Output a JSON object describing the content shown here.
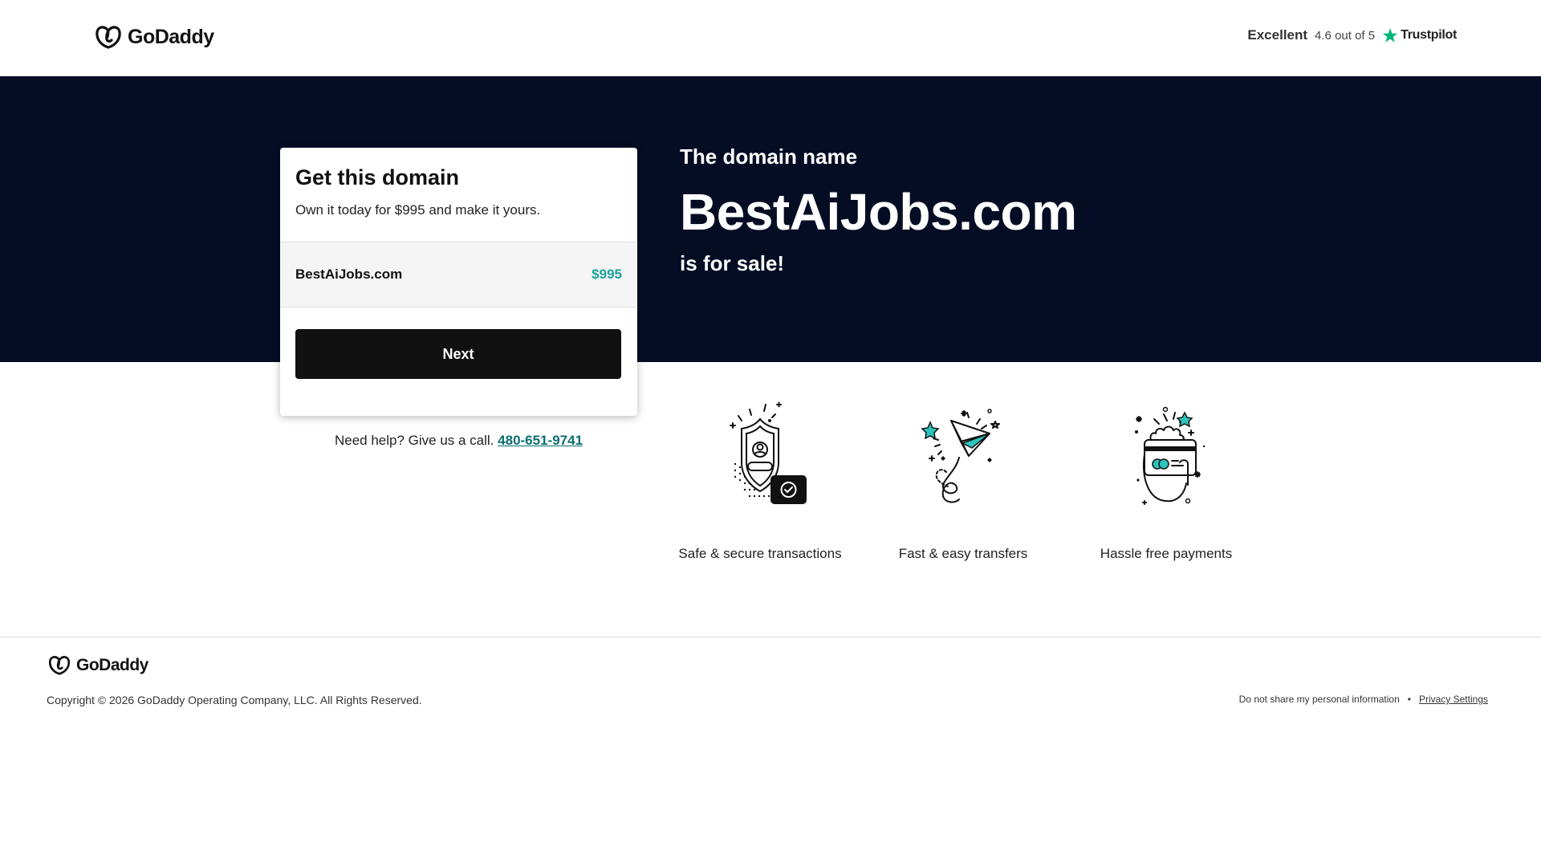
{
  "header": {
    "logo_text": "GoDaddy",
    "trustpilot": {
      "rating_word": "Excellent",
      "score_text": "4.6 out of 5",
      "brand": "Trustpilot",
      "star_color": "#00b67a"
    }
  },
  "hero": {
    "pre_text": "The domain name",
    "domain": "BestAiJobs.com",
    "post_text": "is for sale!",
    "background_color": "#040d24"
  },
  "card": {
    "title": "Get this domain",
    "subtitle": "Own it today for $995 and make it yours.",
    "item_name": "BestAiJobs.com",
    "item_price": "$995",
    "price_color": "#1ba39c",
    "button_label": "Next"
  },
  "help": {
    "text": "Need help? Give us a call.",
    "phone": "480-651-9741"
  },
  "features": [
    {
      "icon": "shield-icon",
      "label": "Safe & secure transactions"
    },
    {
      "icon": "paper-plane-icon",
      "label": "Fast & easy transfers"
    },
    {
      "icon": "credit-card-icon",
      "label": "Hassle free payments"
    }
  ],
  "footer": {
    "logo_text": "GoDaddy",
    "copyright": "Copyright © 2026 GoDaddy Operating Company, LLC. All Rights Reserved.",
    "do_not_share": "Do not share my personal information",
    "separator": "•",
    "privacy_settings": "Privacy Settings"
  }
}
